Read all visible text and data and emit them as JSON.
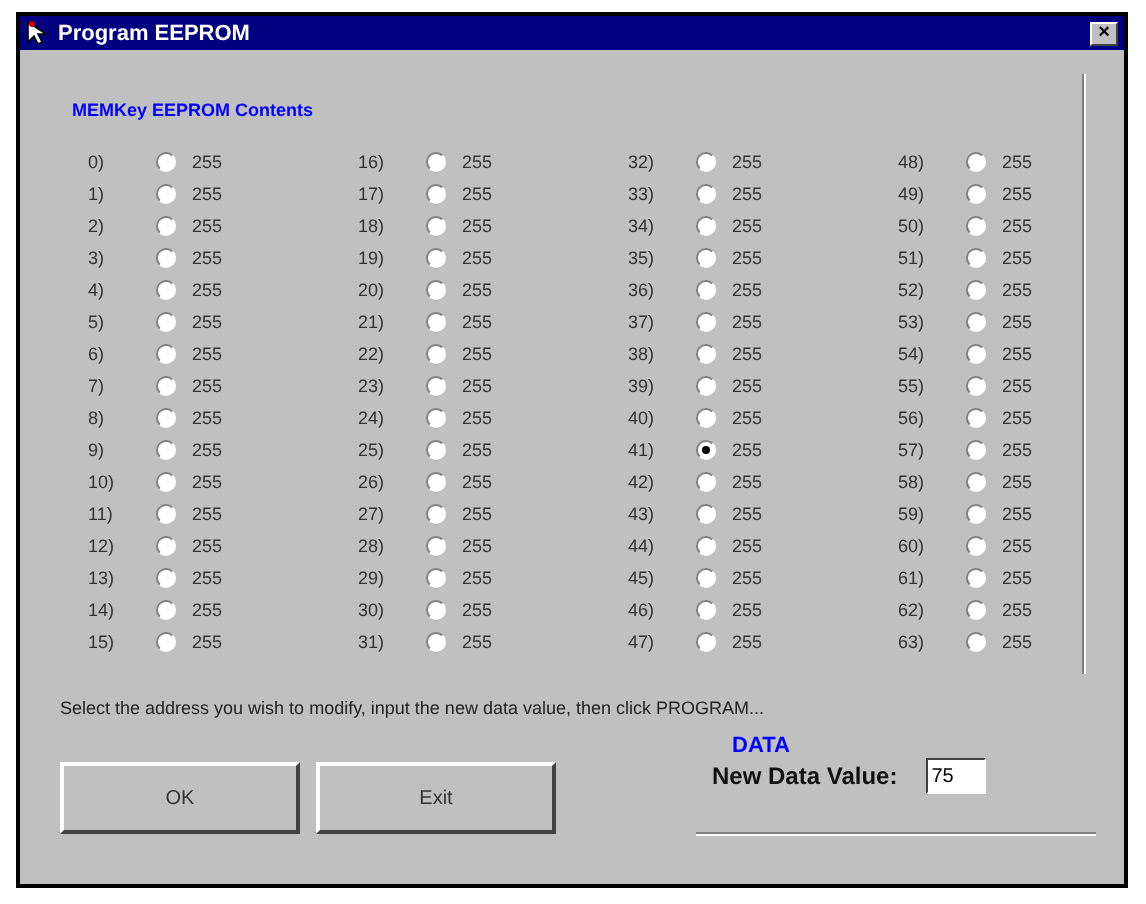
{
  "window": {
    "title": "Program EEPROM",
    "close": "×"
  },
  "group": {
    "title": "MEMKey EEPROM Contents"
  },
  "cells": [
    {
      "address": "0)",
      "value": "255",
      "selected": false
    },
    {
      "address": "1)",
      "value": "255",
      "selected": false
    },
    {
      "address": "2)",
      "value": "255",
      "selected": false
    },
    {
      "address": "3)",
      "value": "255",
      "selected": false
    },
    {
      "address": "4)",
      "value": "255",
      "selected": false
    },
    {
      "address": "5)",
      "value": "255",
      "selected": false
    },
    {
      "address": "6)",
      "value": "255",
      "selected": false
    },
    {
      "address": "7)",
      "value": "255",
      "selected": false
    },
    {
      "address": "8)",
      "value": "255",
      "selected": false
    },
    {
      "address": "9)",
      "value": "255",
      "selected": false
    },
    {
      "address": "10)",
      "value": "255",
      "selected": false
    },
    {
      "address": "11)",
      "value": "255",
      "selected": false
    },
    {
      "address": "12)",
      "value": "255",
      "selected": false
    },
    {
      "address": "13)",
      "value": "255",
      "selected": false
    },
    {
      "address": "14)",
      "value": "255",
      "selected": false
    },
    {
      "address": "15)",
      "value": "255",
      "selected": false
    },
    {
      "address": "16)",
      "value": "255",
      "selected": false
    },
    {
      "address": "17)",
      "value": "255",
      "selected": false
    },
    {
      "address": "18)",
      "value": "255",
      "selected": false
    },
    {
      "address": "19)",
      "value": "255",
      "selected": false
    },
    {
      "address": "20)",
      "value": "255",
      "selected": false
    },
    {
      "address": "21)",
      "value": "255",
      "selected": false
    },
    {
      "address": "22)",
      "value": "255",
      "selected": false
    },
    {
      "address": "23)",
      "value": "255",
      "selected": false
    },
    {
      "address": "24)",
      "value": "255",
      "selected": false
    },
    {
      "address": "25)",
      "value": "255",
      "selected": false
    },
    {
      "address": "26)",
      "value": "255",
      "selected": false
    },
    {
      "address": "27)",
      "value": "255",
      "selected": false
    },
    {
      "address": "28)",
      "value": "255",
      "selected": false
    },
    {
      "address": "29)",
      "value": "255",
      "selected": false
    },
    {
      "address": "30)",
      "value": "255",
      "selected": false
    },
    {
      "address": "31)",
      "value": "255",
      "selected": false
    },
    {
      "address": "32)",
      "value": "255",
      "selected": false
    },
    {
      "address": "33)",
      "value": "255",
      "selected": false
    },
    {
      "address": "34)",
      "value": "255",
      "selected": false
    },
    {
      "address": "35)",
      "value": "255",
      "selected": false
    },
    {
      "address": "36)",
      "value": "255",
      "selected": false
    },
    {
      "address": "37)",
      "value": "255",
      "selected": false
    },
    {
      "address": "38)",
      "value": "255",
      "selected": false
    },
    {
      "address": "39)",
      "value": "255",
      "selected": false
    },
    {
      "address": "40)",
      "value": "255",
      "selected": false
    },
    {
      "address": "41)",
      "value": "255",
      "selected": true
    },
    {
      "address": "42)",
      "value": "255",
      "selected": false
    },
    {
      "address": "43)",
      "value": "255",
      "selected": false
    },
    {
      "address": "44)",
      "value": "255",
      "selected": false
    },
    {
      "address": "45)",
      "value": "255",
      "selected": false
    },
    {
      "address": "46)",
      "value": "255",
      "selected": false
    },
    {
      "address": "47)",
      "value": "255",
      "selected": false
    },
    {
      "address": "48)",
      "value": "255",
      "selected": false
    },
    {
      "address": "49)",
      "value": "255",
      "selected": false
    },
    {
      "address": "50)",
      "value": "255",
      "selected": false
    },
    {
      "address": "51)",
      "value": "255",
      "selected": false
    },
    {
      "address": "52)",
      "value": "255",
      "selected": false
    },
    {
      "address": "53)",
      "value": "255",
      "selected": false
    },
    {
      "address": "54)",
      "value": "255",
      "selected": false
    },
    {
      "address": "55)",
      "value": "255",
      "selected": false
    },
    {
      "address": "56)",
      "value": "255",
      "selected": false
    },
    {
      "address": "57)",
      "value": "255",
      "selected": false
    },
    {
      "address": "58)",
      "value": "255",
      "selected": false
    },
    {
      "address": "59)",
      "value": "255",
      "selected": false
    },
    {
      "address": "60)",
      "value": "255",
      "selected": false
    },
    {
      "address": "61)",
      "value": "255",
      "selected": false
    },
    {
      "address": "62)",
      "value": "255",
      "selected": false
    },
    {
      "address": "63)",
      "value": "255",
      "selected": false
    }
  ],
  "instruction": "Select the address you wish to modify, input the new data value, then click PROGRAM...",
  "buttons": [
    "OK",
    "Exit"
  ],
  "data": {
    "heading": "DATA",
    "label": "New Data Value:",
    "value": "75"
  }
}
